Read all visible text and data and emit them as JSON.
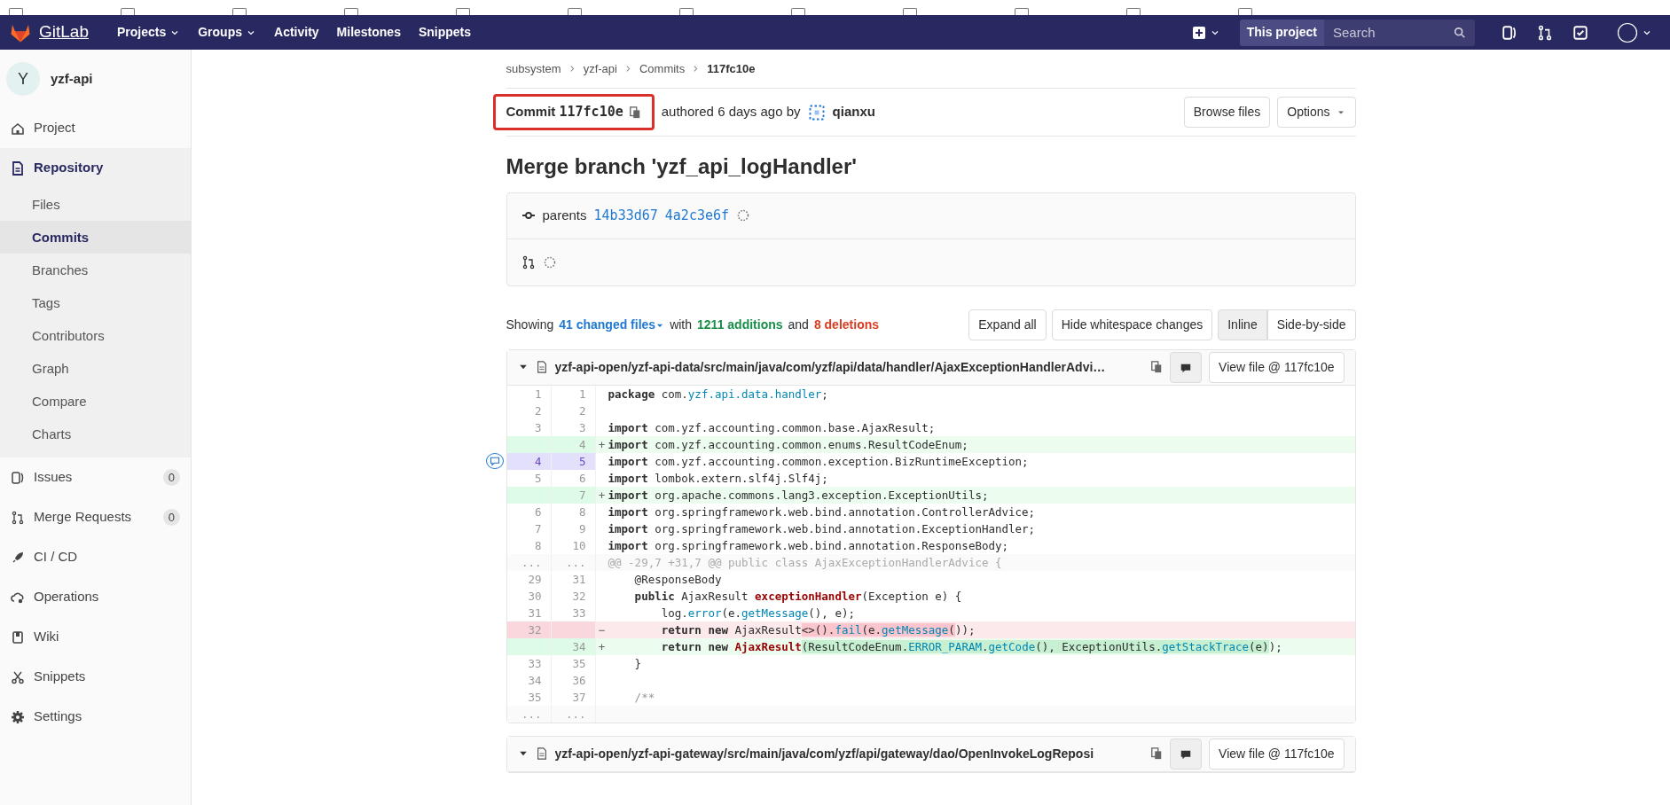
{
  "navbar": {
    "brand": "GitLab",
    "menu": [
      {
        "label": "Projects",
        "dropdown": true
      },
      {
        "label": "Groups",
        "dropdown": true
      },
      {
        "label": "Activity",
        "dropdown": false
      },
      {
        "label": "Milestones",
        "dropdown": false
      },
      {
        "label": "Snippets",
        "dropdown": false
      }
    ],
    "scope": "This project",
    "search": {
      "placeholder": "Search"
    }
  },
  "sidebar": {
    "project": {
      "initial": "Y",
      "name": "yzf-api"
    },
    "items": [
      {
        "label": "Project",
        "selected": false
      },
      {
        "label": "Repository",
        "selected": true,
        "expanded": true,
        "children": [
          {
            "label": "Files",
            "selected": false
          },
          {
            "label": "Commits",
            "selected": true
          },
          {
            "label": "Branches",
            "selected": false
          },
          {
            "label": "Tags",
            "selected": false
          },
          {
            "label": "Contributors",
            "selected": false
          },
          {
            "label": "Graph",
            "selected": false
          },
          {
            "label": "Compare",
            "selected": false
          },
          {
            "label": "Charts",
            "selected": false
          }
        ]
      },
      {
        "label": "Issues",
        "selected": false,
        "count": "0"
      },
      {
        "label": "Merge Requests",
        "selected": false,
        "count": "0"
      },
      {
        "label": "CI / CD",
        "selected": false
      },
      {
        "label": "Operations",
        "selected": false
      },
      {
        "label": "Wiki",
        "selected": false
      },
      {
        "label": "Snippets",
        "selected": false
      },
      {
        "label": "Settings",
        "selected": false
      }
    ]
  },
  "breadcrumb": [
    "subsystem",
    "yzf-api",
    "Commits",
    "117fc10e"
  ],
  "commit": {
    "label": "Commit",
    "sha": "117fc10e",
    "outlined": true,
    "authored": "authored 6 days ago by",
    "author": "qianxu",
    "buttons": [
      "Browse files",
      "Options"
    ],
    "title": "Merge branch 'yzf_api_logHandler'",
    "parents_label": "parents",
    "parents": [
      "14b33d67",
      "4a2c3e6f"
    ]
  },
  "stats": {
    "showing": "Showing",
    "files": "41 changed files",
    "with": "with",
    "additions": "1211 additions",
    "and": "and",
    "deletions": "8 deletions",
    "buttons": [
      "Expand all",
      "Hide whitespace changes"
    ],
    "views": [
      {
        "label": "Inline",
        "selected": true
      },
      {
        "label": "Side-by-side",
        "selected": false
      }
    ]
  },
  "files": [
    {
      "path": "yzf-api-open/yzf-api-data/src/main/java/com/yzf/api/data/handler/AjaxExceptionHandlerAdvi…",
      "view": "View file @ 117fc10e",
      "lines": [
        {
          "kind": "context",
          "old": "1",
          "new": "1",
          "selected": false,
          "code": [
            {
              "t": "package",
              "kind": "keyword"
            },
            {
              "t": " com.",
              "kind": "plain"
            },
            {
              "t": "yzf.api.data.handler",
              "kind": "name"
            },
            {
              "t": ";",
              "kind": "plain"
            }
          ]
        },
        {
          "kind": "context",
          "old": "2",
          "new": "2",
          "selected": false
        },
        {
          "kind": "context",
          "old": "3",
          "new": "3",
          "selected": false,
          "code": [
            {
              "t": "import",
              "kind": "keyword"
            },
            {
              "t": " com.yzf.accounting.common.base.AjaxResult;",
              "kind": "plain"
            }
          ]
        },
        {
          "kind": "added",
          "new": "4",
          "sign": "+",
          "selected": false,
          "code": [
            {
              "t": "import",
              "kind": "keyword"
            },
            {
              "t": " com.yzf.accounting.common.enums.ResultCodeEnum;",
              "kind": "plain"
            }
          ]
        },
        {
          "kind": "context",
          "old": "4",
          "new": "5",
          "selected": true,
          "code": [
            {
              "t": "import",
              "kind": "keyword"
            },
            {
              "t": " com.yzf.accounting.common.exception.BizRuntimeException;",
              "kind": "plain"
            }
          ]
        },
        {
          "kind": "context",
          "old": "5",
          "new": "6",
          "selected": false,
          "code": [
            {
              "t": "import",
              "kind": "keyword"
            },
            {
              "t": " lombok.extern.slf4j.Slf4j;",
              "kind": "plain"
            }
          ]
        },
        {
          "kind": "added",
          "new": "7",
          "sign": "+",
          "selected": false,
          "code": [
            {
              "t": "import",
              "kind": "keyword"
            },
            {
              "t": " org.apache.commons.lang3.exception.ExceptionUtils;",
              "kind": "plain"
            }
          ]
        },
        {
          "kind": "context",
          "old": "6",
          "new": "8",
          "selected": false,
          "code": [
            {
              "t": "import",
              "kind": "keyword"
            },
            {
              "t": " org.springframework.web.bind.annotation.ControllerAdvice;",
              "kind": "plain"
            }
          ]
        },
        {
          "kind": "context",
          "old": "7",
          "new": "9",
          "selected": false,
          "code": [
            {
              "t": "import",
              "kind": "keyword"
            },
            {
              "t": " org.springframework.web.bind.annotation.ExceptionHandler;",
              "kind": "plain"
            }
          ]
        },
        {
          "kind": "context",
          "old": "8",
          "new": "10",
          "selected": false,
          "code": [
            {
              "t": "import",
              "kind": "keyword"
            },
            {
              "t": " org.springframework.web.bind.annotation.ResponseBody;",
              "kind": "plain"
            }
          ]
        },
        {
          "kind": "hunk",
          "old": "...",
          "new": "...",
          "selected": false,
          "code": [
            {
              "t": "@@ -29,7 +31,7 @@ public class AjaxExceptionHandlerAdvice {",
              "kind": "plain"
            }
          ]
        },
        {
          "kind": "context",
          "old": "29",
          "new": "31",
          "selected": false,
          "code": [
            {
              "t": "    @ResponseBody",
              "kind": "plain"
            }
          ]
        },
        {
          "kind": "context",
          "old": "30",
          "new": "32",
          "selected": false,
          "code": [
            {
              "t": "    public",
              "kind": "keyword"
            },
            {
              "t": " AjaxResult ",
              "kind": "plain"
            },
            {
              "t": "exceptionHandler",
              "kind": "function"
            },
            {
              "t": "(Exception e) {",
              "kind": "plain"
            }
          ]
        },
        {
          "kind": "context",
          "old": "31",
          "new": "33",
          "selected": false,
          "code": [
            {
              "t": "        log.",
              "kind": "plain"
            },
            {
              "t": "error",
              "kind": "name"
            },
            {
              "t": "(e.",
              "kind": "plain"
            },
            {
              "t": "getMessage",
              "kind": "name"
            },
            {
              "t": "(), e);",
              "kind": "plain"
            }
          ]
        },
        {
          "kind": "removed",
          "old": "32",
          "sign": "−",
          "selected": false,
          "code": [
            {
              "t": "        return new",
              "kind": "keyword"
            },
            {
              "t": " AjaxResult",
              "kind": "plain"
            },
            {
              "t": "<>().",
              "kind": "changed"
            },
            {
              "t": "fail",
              "kind": "changed-name"
            },
            {
              "t": "(e.",
              "kind": "changed"
            },
            {
              "t": "getMessage",
              "kind": "changed-name"
            },
            {
              "t": "(",
              "kind": "changed"
            },
            {
              "t": "));",
              "kind": "plain"
            }
          ]
        },
        {
          "kind": "added",
          "new": "34",
          "sign": "+",
          "selected": false,
          "code": [
            {
              "t": "        return new ",
              "kind": "keyword"
            },
            {
              "t": "AjaxResult",
              "kind": "function"
            },
            {
              "t": "(ResultCodeEnum.",
              "kind": "changed"
            },
            {
              "t": "ERROR_PARAM",
              "kind": "changed-name"
            },
            {
              "t": ".",
              "kind": "changed"
            },
            {
              "t": "getCode",
              "kind": "changed-name"
            },
            {
              "t": "(), ExceptionUtils.",
              "kind": "changed"
            },
            {
              "t": "getStackTrace",
              "kind": "changed-name"
            },
            {
              "t": "(e)",
              "kind": "changed"
            },
            {
              "t": ");",
              "kind": "plain"
            }
          ]
        },
        {
          "kind": "context",
          "old": "33",
          "new": "35",
          "selected": false,
          "code": [
            {
              "t": "    }",
              "kind": "plain"
            }
          ]
        },
        {
          "kind": "context",
          "old": "34",
          "new": "36",
          "selected": false
        },
        {
          "kind": "context",
          "old": "35",
          "new": "37",
          "selected": false,
          "code": [
            {
              "t": "    /**",
              "kind": "comment"
            }
          ]
        },
        {
          "kind": "expander",
          "old": "...",
          "new": "...",
          "selected": false
        }
      ]
    },
    {
      "path": "yzf-api-open/yzf-api-gateway/src/main/java/com/yzf/api/gateway/dao/OpenInvokeLogReposi",
      "view": "View file @ 117fc10e"
    }
  ]
}
